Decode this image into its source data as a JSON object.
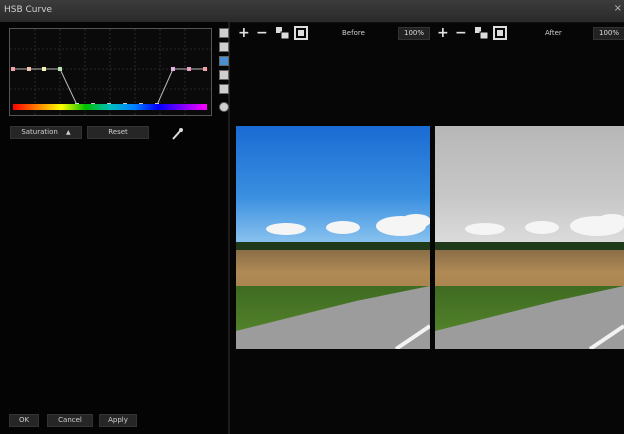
{
  "window": {
    "title": "HSB Curve",
    "close_glyph": "×"
  },
  "curve": {
    "mode_label": "Saturation",
    "mode_arrow": "▲",
    "reset_label": "Reset",
    "picker_icon": "eyedropper-icon"
  },
  "footer": {
    "ok_label": "OK",
    "cancel_label": "Cancel",
    "apply_label": "Apply"
  },
  "toolbar": {
    "zoom_in": "+",
    "zoom_out": "−",
    "before_label": "Before",
    "after_label": "After",
    "before_zoom": "100%",
    "after_zoom": "100%"
  },
  "colors": {
    "accent": "#1a6bd3",
    "panel": "#040404",
    "hue_start": "#ff0000",
    "hue_end": "#ff00ff"
  }
}
